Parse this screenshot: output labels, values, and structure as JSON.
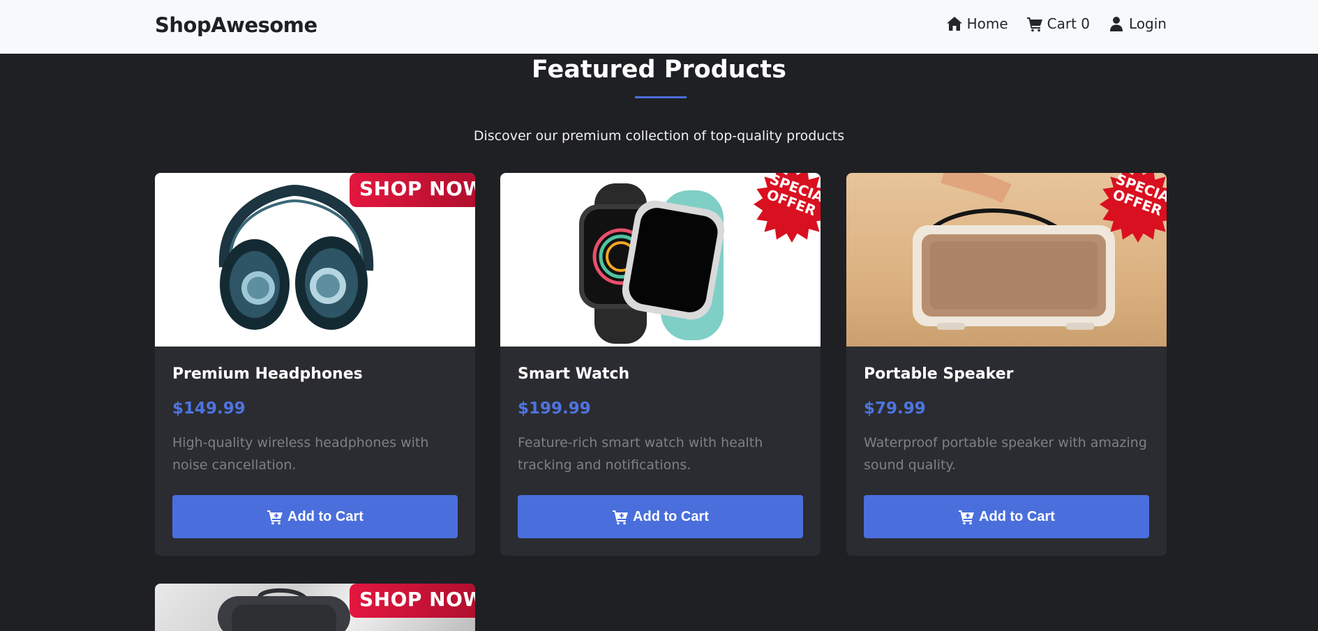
{
  "navbar": {
    "brand": "ShopAwesome",
    "links": {
      "home": "Home",
      "cart": "Cart 0",
      "login": "Login"
    }
  },
  "section": {
    "title": "Featured Products",
    "subtitle": "Discover our premium collection of top-quality products"
  },
  "products": [
    {
      "name": "Premium Headphones",
      "price": "$149.99",
      "description": "High-quality wireless headphones with noise cancellation.",
      "button": "Add to Cart",
      "badge": "SHOP NOW"
    },
    {
      "name": "Smart Watch",
      "price": "$199.99",
      "description": "Feature-rich smart watch with health tracking and notifications.",
      "button": "Add to Cart",
      "badge": "SPECIAL OFFER"
    },
    {
      "name": "Portable Speaker",
      "price": "$79.99",
      "description": "Waterproof portable speaker with amazing sound quality.",
      "button": "Add to Cart",
      "badge": "SPECIAL OFFER"
    },
    {
      "badge": "SHOP NOW"
    }
  ],
  "colors": {
    "background": "#1f2024",
    "card": "#2b2c31",
    "accent": "#4a6fdc",
    "price": "#4e74e0",
    "navbar": "#f8f9fa",
    "badge_red": "#e3173f"
  },
  "icons": {
    "home": "home-icon",
    "cart": "cart-icon",
    "login": "user-icon",
    "add_to_cart": "cart-plus-icon"
  }
}
